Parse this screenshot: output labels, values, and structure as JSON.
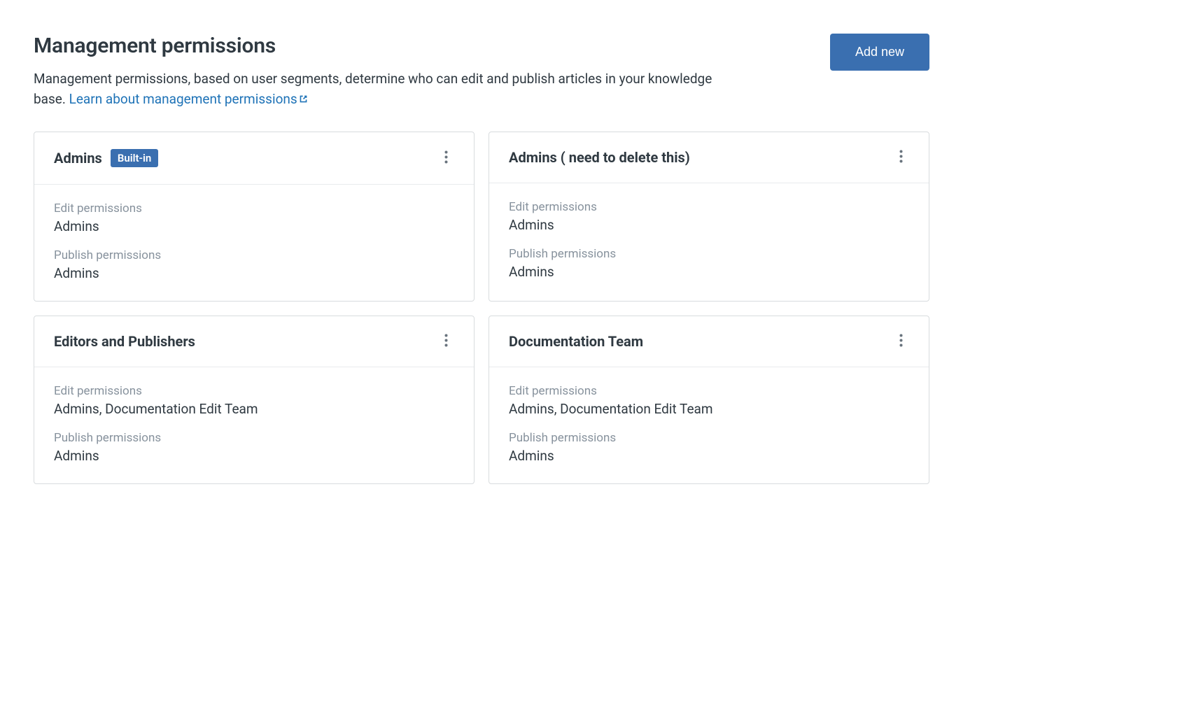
{
  "header": {
    "title": "Management permissions",
    "description_prefix": "Management permissions, based on user segments, determine who can edit and publish articles in your knowledge base. ",
    "learn_link_text": "Learn about management permissions",
    "add_button_label": "Add new"
  },
  "labels": {
    "edit_permissions": "Edit permissions",
    "publish_permissions": "Publish permissions",
    "builtin_badge": "Built-in"
  },
  "cards": [
    {
      "title": "Admins",
      "builtin": true,
      "edit_value": "Admins",
      "publish_value": "Admins"
    },
    {
      "title": "Admins ( need to delete this)",
      "builtin": false,
      "edit_value": "Admins",
      "publish_value": "Admins"
    },
    {
      "title": "Editors and Publishers",
      "builtin": false,
      "edit_value": "Admins, Documentation Edit Team",
      "publish_value": "Admins"
    },
    {
      "title": "Documentation Team",
      "builtin": false,
      "edit_value": "Admins, Documentation Edit Team",
      "publish_value": "Admins"
    }
  ]
}
